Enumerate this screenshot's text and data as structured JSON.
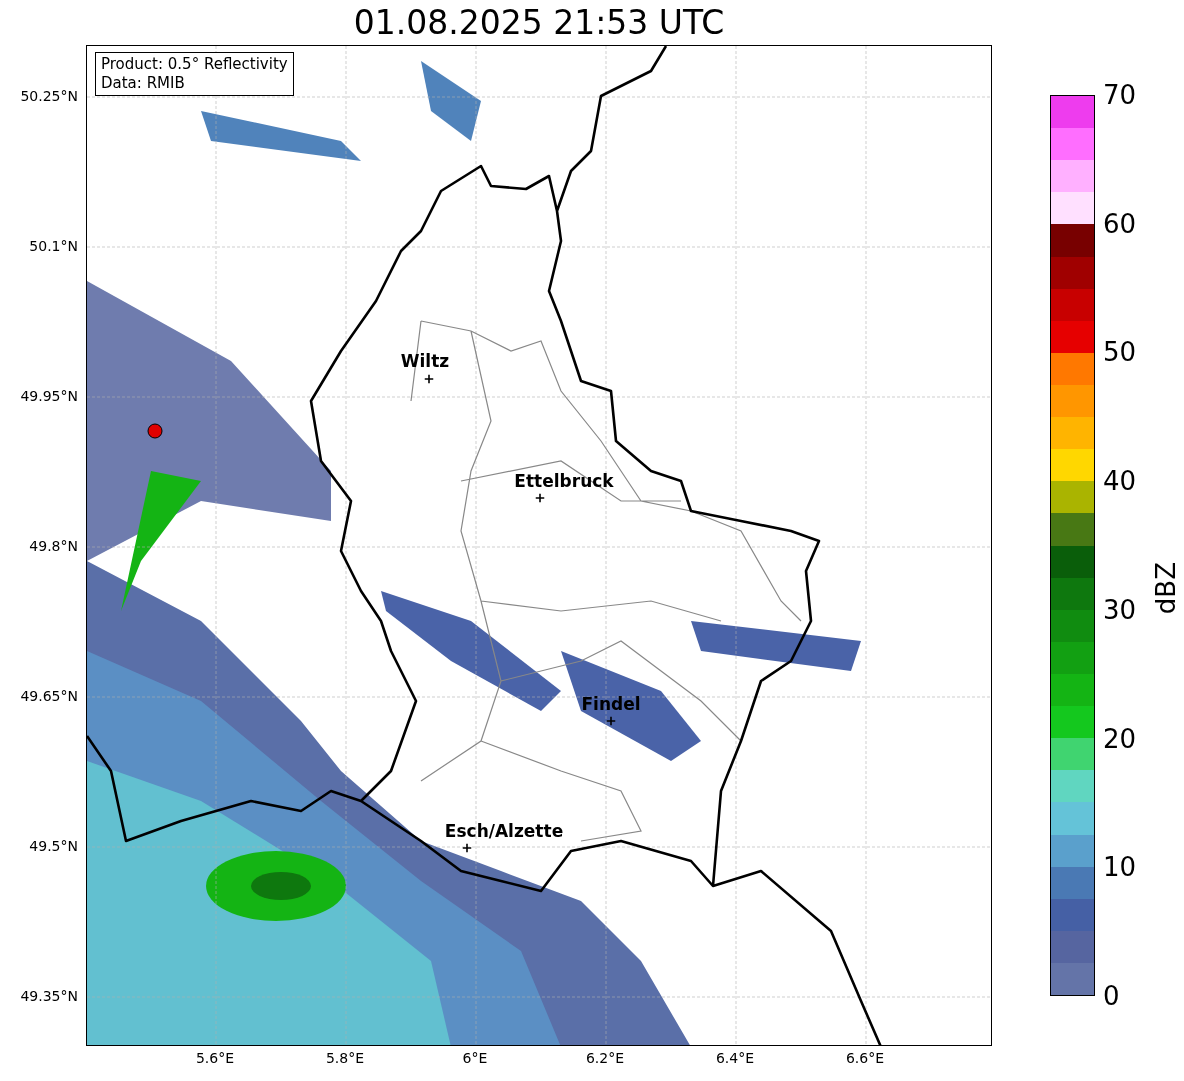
{
  "title": "01.08.2025 21:53 UTC",
  "info_box": {
    "lines": [
      "Product: 0.5° Reflectivity",
      "Data: RMIB"
    ]
  },
  "map": {
    "cities": [
      "Wiltz",
      "Ettelbruck",
      "Findel",
      "Esch/Alzette"
    ]
  },
  "y_ticks": [
    "50.25°N",
    "50.1°N",
    "49.95°N",
    "49.8°N",
    "49.65°N",
    "49.5°N",
    "49.35°N"
  ],
  "x_ticks": [
    "5.6°E",
    "5.8°E",
    "6°E",
    "6.2°E",
    "6.4°E",
    "6.6°E"
  ],
  "colorbar": {
    "label": "dBZ",
    "ticks": [
      "70",
      "60",
      "50",
      "40",
      "30",
      "20",
      "10",
      "0"
    ],
    "bands": [
      {
        "color": "#ee3cee"
      },
      {
        "color": "#ff6eff"
      },
      {
        "color": "#ffb0ff"
      },
      {
        "color": "#ffe0ff"
      },
      {
        "color": "#780000"
      },
      {
        "color": "#a00000"
      },
      {
        "color": "#c80000"
      },
      {
        "color": "#e60000"
      },
      {
        "color": "#ff7800"
      },
      {
        "color": "#ff9600"
      },
      {
        "color": "#ffb400"
      },
      {
        "color": "#ffd700"
      },
      {
        "color": "#aab400"
      },
      {
        "color": "#487814"
      },
      {
        "color": "#0a5e0a"
      },
      {
        "color": "#0e780e"
      },
      {
        "color": "#108c10"
      },
      {
        "color": "#12a012"
      },
      {
        "color": "#14b414"
      },
      {
        "color": "#14c81e"
      },
      {
        "color": "#40d470"
      },
      {
        "color": "#60d6c0"
      },
      {
        "color": "#64c3d8"
      },
      {
        "color": "#5aa0cc"
      },
      {
        "color": "#4a79b4"
      },
      {
        "color": "#4560a5"
      },
      {
        "color": "#5665a0"
      },
      {
        "color": "#6474a8"
      }
    ]
  }
}
